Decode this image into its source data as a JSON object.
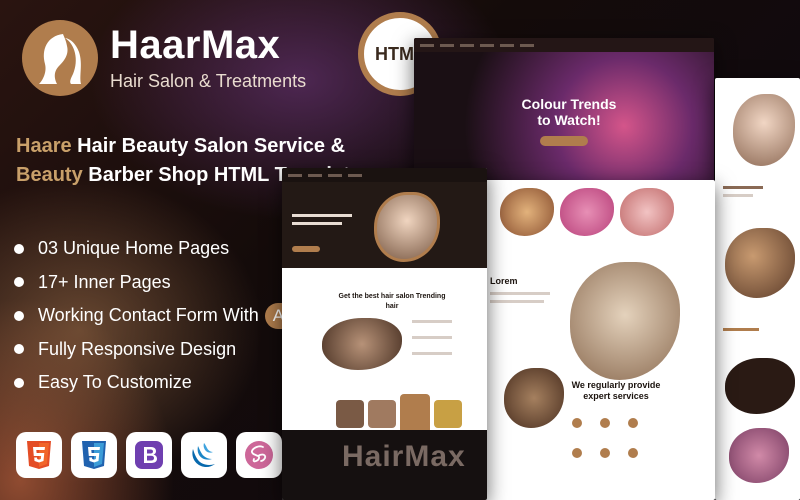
{
  "brand": {
    "name": "HaarMax",
    "tagline": "Hair Salon & Treatments"
  },
  "badge": {
    "label": "HTML"
  },
  "headline": {
    "line1_accent": "Haare",
    "line1_rest": " Hair Beauty Salon Service &",
    "line2_accent": "Beauty",
    "line2_rest": " Barber Shop HTML Template"
  },
  "features": [
    {
      "label": "03 Unique Home Pages"
    },
    {
      "label": "17+ Inner Pages"
    },
    {
      "label": "Working Contact Form With",
      "badge": "Ajax"
    },
    {
      "label": "Fully Responsive Design"
    },
    {
      "label": "Easy To Customize"
    }
  ],
  "tech_icons": [
    {
      "name": "html5-icon",
      "color": "#e44d26"
    },
    {
      "name": "css3-icon",
      "color": "#2062af"
    },
    {
      "name": "bootstrap-icon",
      "color": "#6f3fb0"
    },
    {
      "name": "jquery-icon",
      "color": "#0769ad"
    },
    {
      "name": "sass-icon",
      "color": "#cd6799"
    }
  ],
  "colors": {
    "accent": "#b07d4d",
    "gold_text": "#c9a06a",
    "background": "#120a07"
  },
  "mockups": {
    "back_hero": "Colour Trends to Watch!",
    "main_heading": "We regularly provide expert services",
    "front_heading": "Get the best hair salon Trending hair",
    "front_wordmark": "HairMax"
  }
}
